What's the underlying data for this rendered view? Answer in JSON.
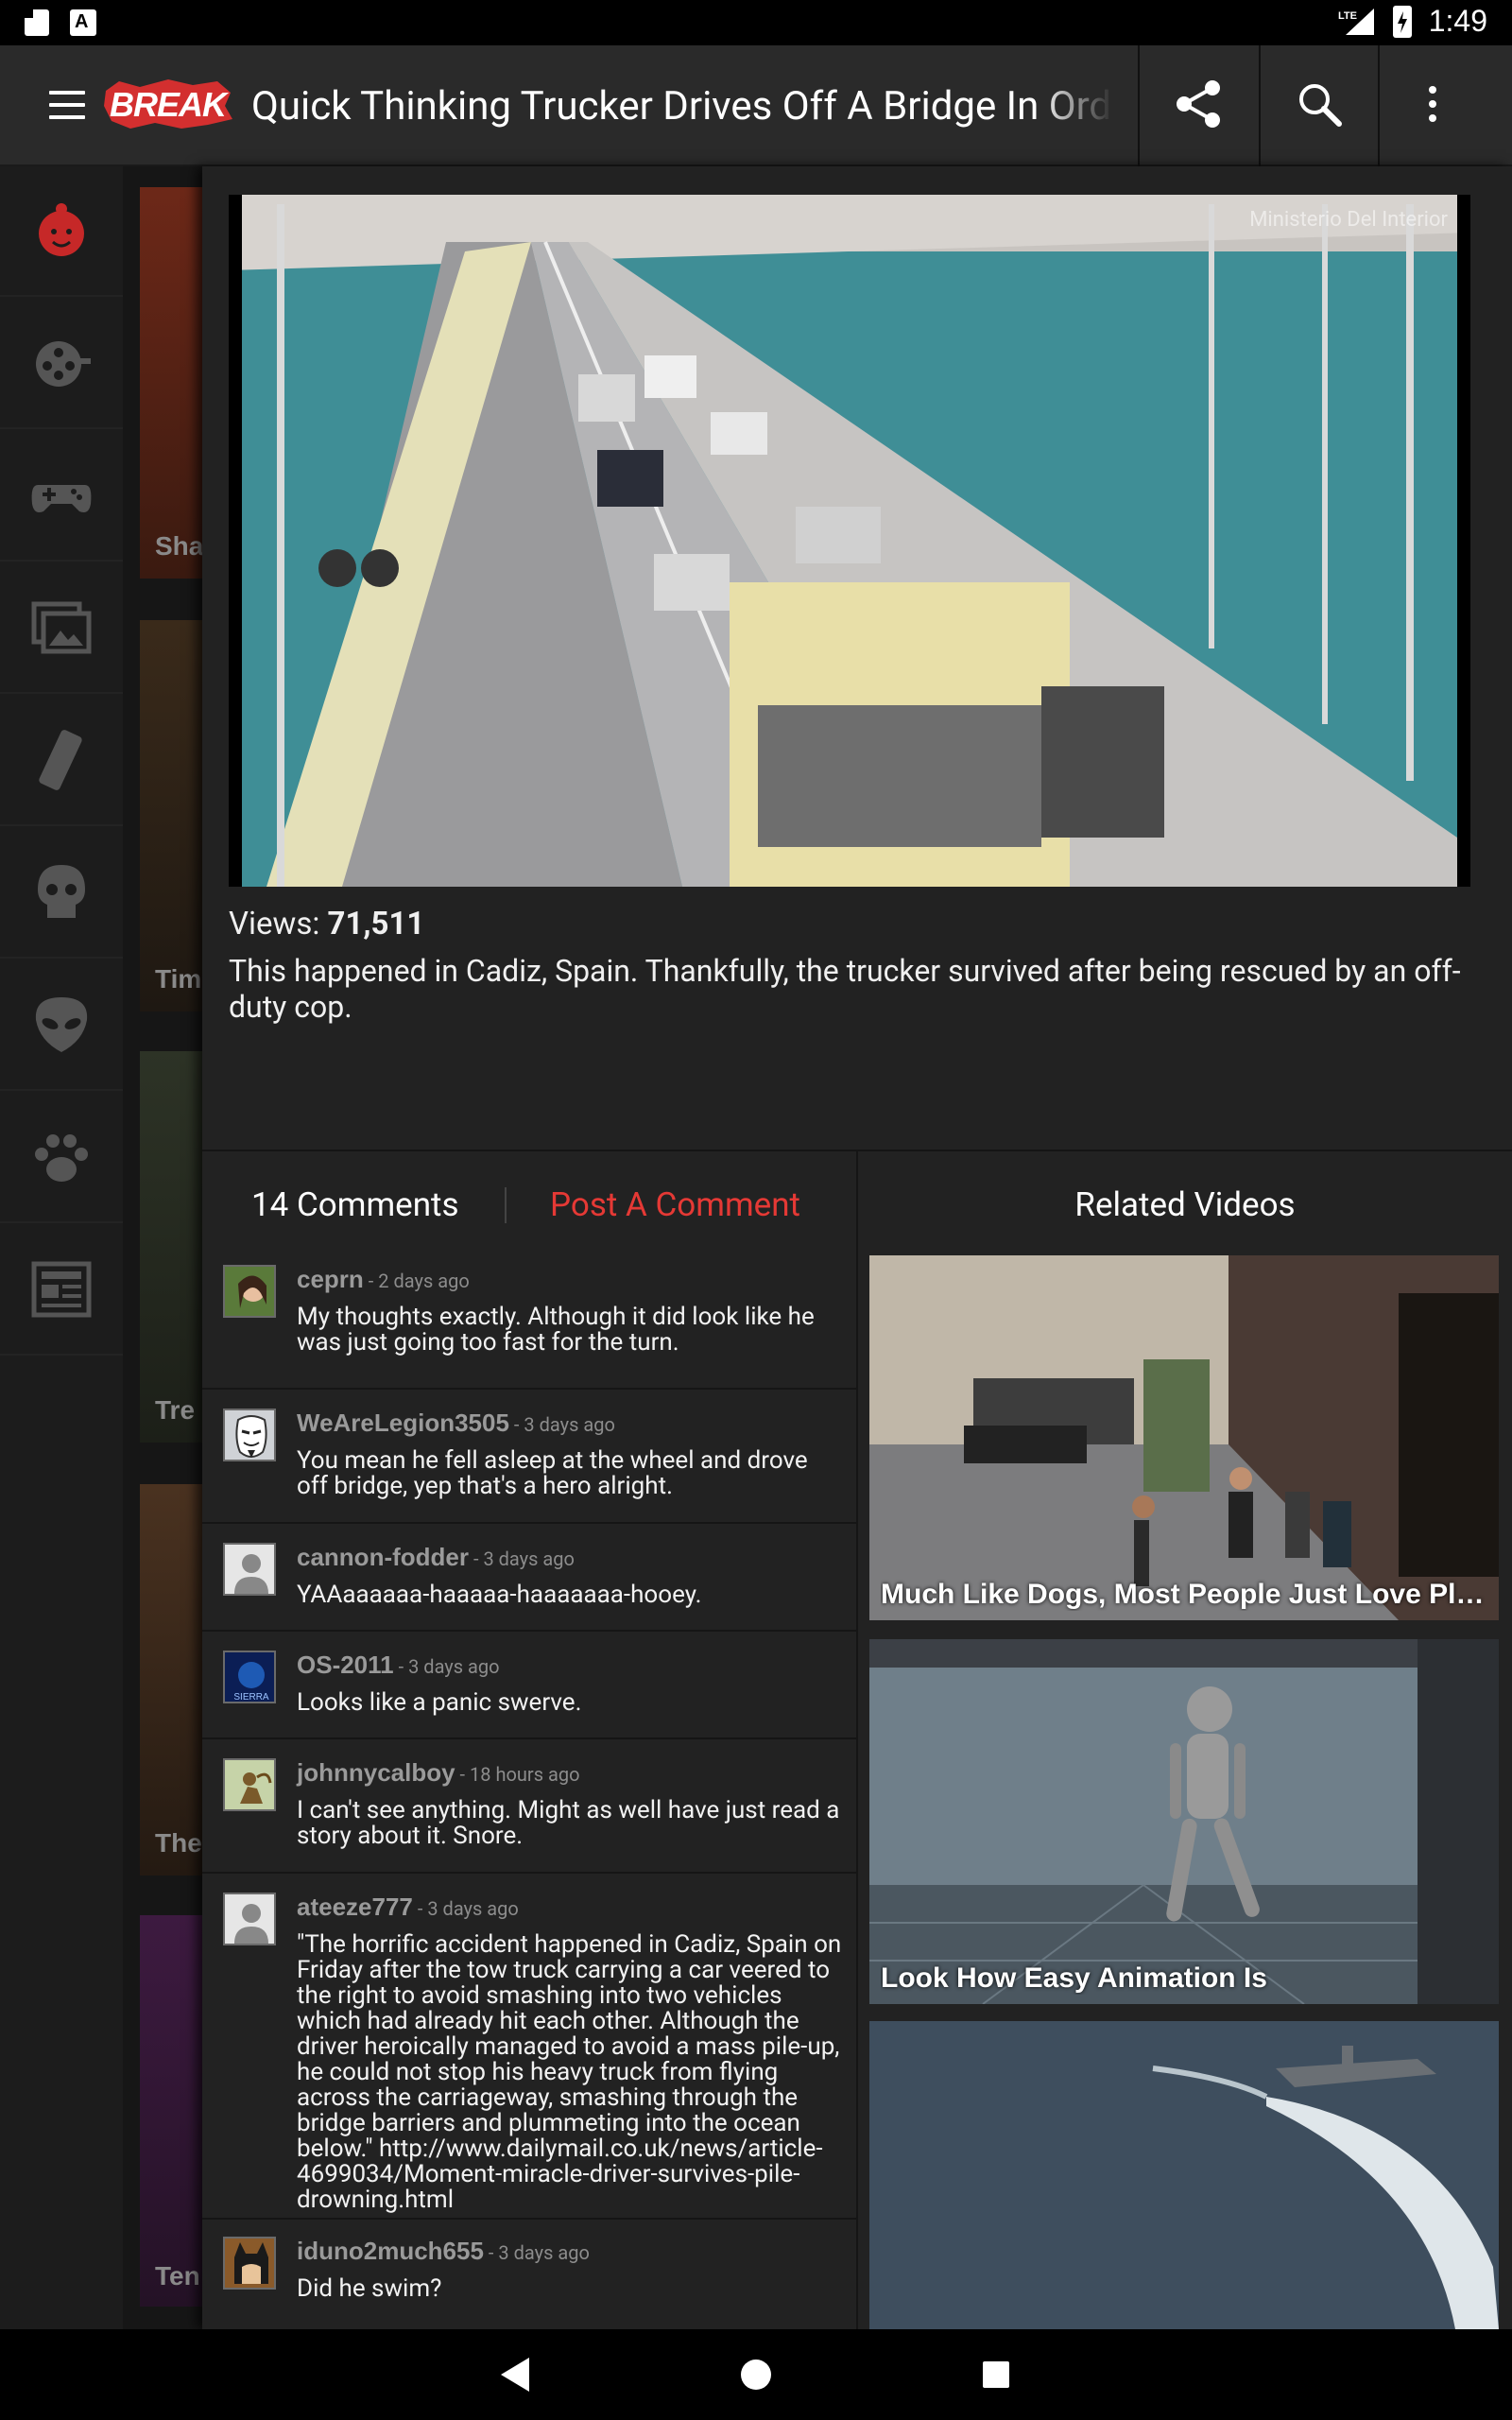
{
  "status_bar": {
    "time": "1:49",
    "network": "LTE"
  },
  "app_bar": {
    "logo_text": "BREAK",
    "title": "Quick Thinking Trucker Drives Off A Bridge In Order To Save Others",
    "share_label": "share-icon",
    "search_label": "search-icon",
    "more_label": "more-icon"
  },
  "rail": {
    "items": [
      "home-icon",
      "video-reel-icon",
      "gamepad-icon",
      "gallery-icon",
      "remote-icon",
      "skull-icon",
      "alien-icon",
      "paw-icon",
      "news-icon"
    ],
    "accent": "#d32f2f"
  },
  "background_cards": [
    "Sha",
    "Tim",
    "Tre",
    "The",
    "Ten"
  ],
  "video": {
    "watermark": "Ministerio Del Interior",
    "views_label": "Views:",
    "views": "71,511",
    "description": "This happened in Cadiz, Spain. Thankfully, the trucker survived after being rescued by an off-duty cop."
  },
  "comments_section": {
    "count_label": "14 Comments",
    "post_label": "Post A Comment",
    "comments": [
      {
        "user": "ceprn",
        "time": " - 2 days ago",
        "text": "My thoughts exactly. Although it did look like he was just going too fast for the turn."
      },
      {
        "user": "WeAreLegion3505",
        "time": " - 3 days ago",
        "text": "You mean he fell asleep at the wheel and drove off bridge, yep that's a hero alright."
      },
      {
        "user": "cannon-fodder",
        "time": " - 3 days ago",
        "text": "YAAaaaaaa-haaaaa-haaaaaaa-hooey."
      },
      {
        "user": "OS-2011",
        "time": " - 3 days ago",
        "text": "Looks like a panic swerve."
      },
      {
        "user": "johnnycalboy",
        "time": " - 18 hours ago",
        "text": "I can't see anything. Might as well have just read a story about it. Snore."
      },
      {
        "user": "ateeze777",
        "time": " - 3 days ago",
        "text": "\"The horrific accident happened in Cadiz, Spain on Friday after the tow truck carrying a car veered to the right to avoid smashing into two vehicles which had already hit each other. Although the driver heroically managed to avoid a mass pile-up, he could not stop his heavy truck from flying across the carriageway, smashing through the bridge barriers and plummeting into the ocean below.\" http://www.dailymail.co.uk/news/article-4699034/Moment-miracle-driver-survives-pile-drowning.html"
      },
      {
        "user": "iduno2much655",
        "time": " - 3 days ago",
        "text": "Did he swim?"
      }
    ]
  },
  "related": {
    "heading": "Related Videos",
    "items": [
      {
        "title": "Much Like Dogs, Most People Just Love Playing Fetch"
      },
      {
        "title": "Look How Easy Animation Is"
      },
      {
        "title": ""
      }
    ]
  },
  "avatar_sierra_text": "SIERRA"
}
